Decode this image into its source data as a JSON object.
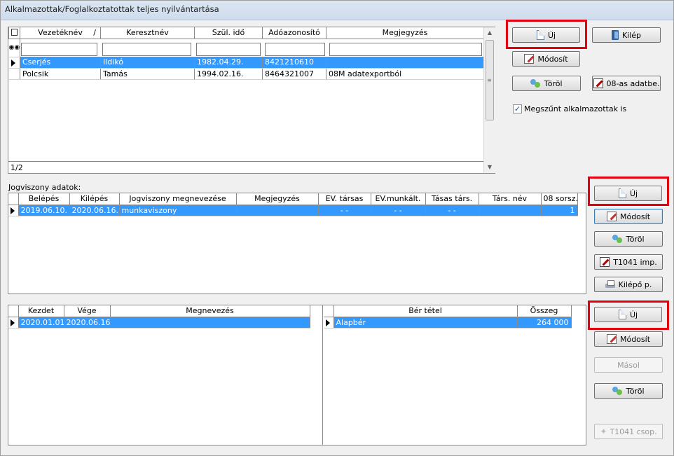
{
  "window": {
    "title": "Alkalmazottak/Foglalkoztatottak teljes nyilvántartása"
  },
  "employees": {
    "columns": [
      "Vezetéknév",
      "Keresztnév",
      "Szül. idő",
      "Adóazonosító",
      "Megjegyzés"
    ],
    "sort_marker": "/",
    "rows": [
      {
        "last": "Cserjés",
        "first": "Ildikó",
        "birth": "1982.04.29.",
        "tax": "8421210610",
        "note": ""
      },
      {
        "last": "Polcsik",
        "first": "Tamás",
        "birth": "1994.02.16.",
        "tax": "8464321007",
        "note": "08M adatexportból"
      }
    ],
    "count": "1/2",
    "buttons": {
      "new": "Új",
      "exit": "Kilép",
      "edit": "Módosít",
      "delete": "Töröl",
      "export08": "08-as adatbe."
    },
    "checkbox_label": "Megszűnt alkalmazottak is",
    "checkbox_checked": true
  },
  "employment": {
    "section_label": "Jogviszony adatok:",
    "columns": [
      "Belépés",
      "Kilépés",
      "Jogviszony megnevezése",
      "Megjegyzés",
      "EV. társas",
      "EV.munkált.",
      "Tásas társ.",
      "Társ. név",
      "08 sorsz."
    ],
    "rows": [
      {
        "start": "2019.06.10.",
        "end": "2020.06.16.",
        "type": "munkaviszony",
        "note": "",
        "ev_tarsas": "- -",
        "ev_munkalt": "- -",
        "tasas_tars": "- -",
        "tars_nev": "",
        "sorsz": "1"
      }
    ],
    "buttons": {
      "new": "Új",
      "edit": "Módosít",
      "delete": "Töröl",
      "t1041": "T1041 imp.",
      "leaver": "Kilépő p."
    }
  },
  "periods": {
    "columns": [
      "Kezdet",
      "Vége",
      "Megnevezés"
    ],
    "rows": [
      {
        "start": "2020.01.01.",
        "end": "2020.06.16.",
        "name": ""
      }
    ]
  },
  "wages": {
    "columns": [
      "Bér tétel",
      "Összeg"
    ],
    "rows": [
      {
        "item": "Alapbér",
        "amount": "264 000"
      }
    ],
    "buttons": {
      "new": "Új",
      "edit": "Módosít",
      "copy": "Másol",
      "delete": "Töröl",
      "t1041_group": "T1041 csop."
    }
  },
  "colors": {
    "selection": "#3399ff",
    "highlight_box": "#e3000f"
  }
}
